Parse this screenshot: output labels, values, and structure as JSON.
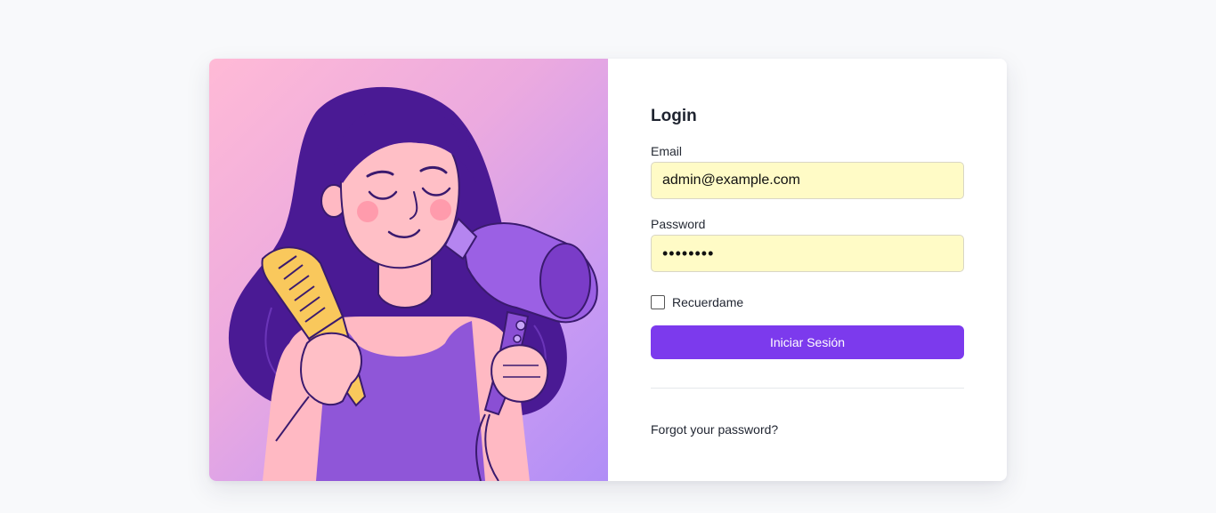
{
  "login": {
    "title": "Login",
    "email_label": "Email",
    "email_value": "admin@example.com",
    "password_label": "Password",
    "password_masked": "••••••••",
    "remember_label": "Recuerdame",
    "remember_checked": false,
    "submit_label": "Iniciar Sesión",
    "forgot_label": "Forgot your password?"
  },
  "theme": {
    "accent": "#7c3aed",
    "autofill_bg": "#fffbc6",
    "page_bg": "#f8f9fb"
  },
  "illustration": {
    "subject": "woman-with-comb-and-hair-dryer"
  }
}
